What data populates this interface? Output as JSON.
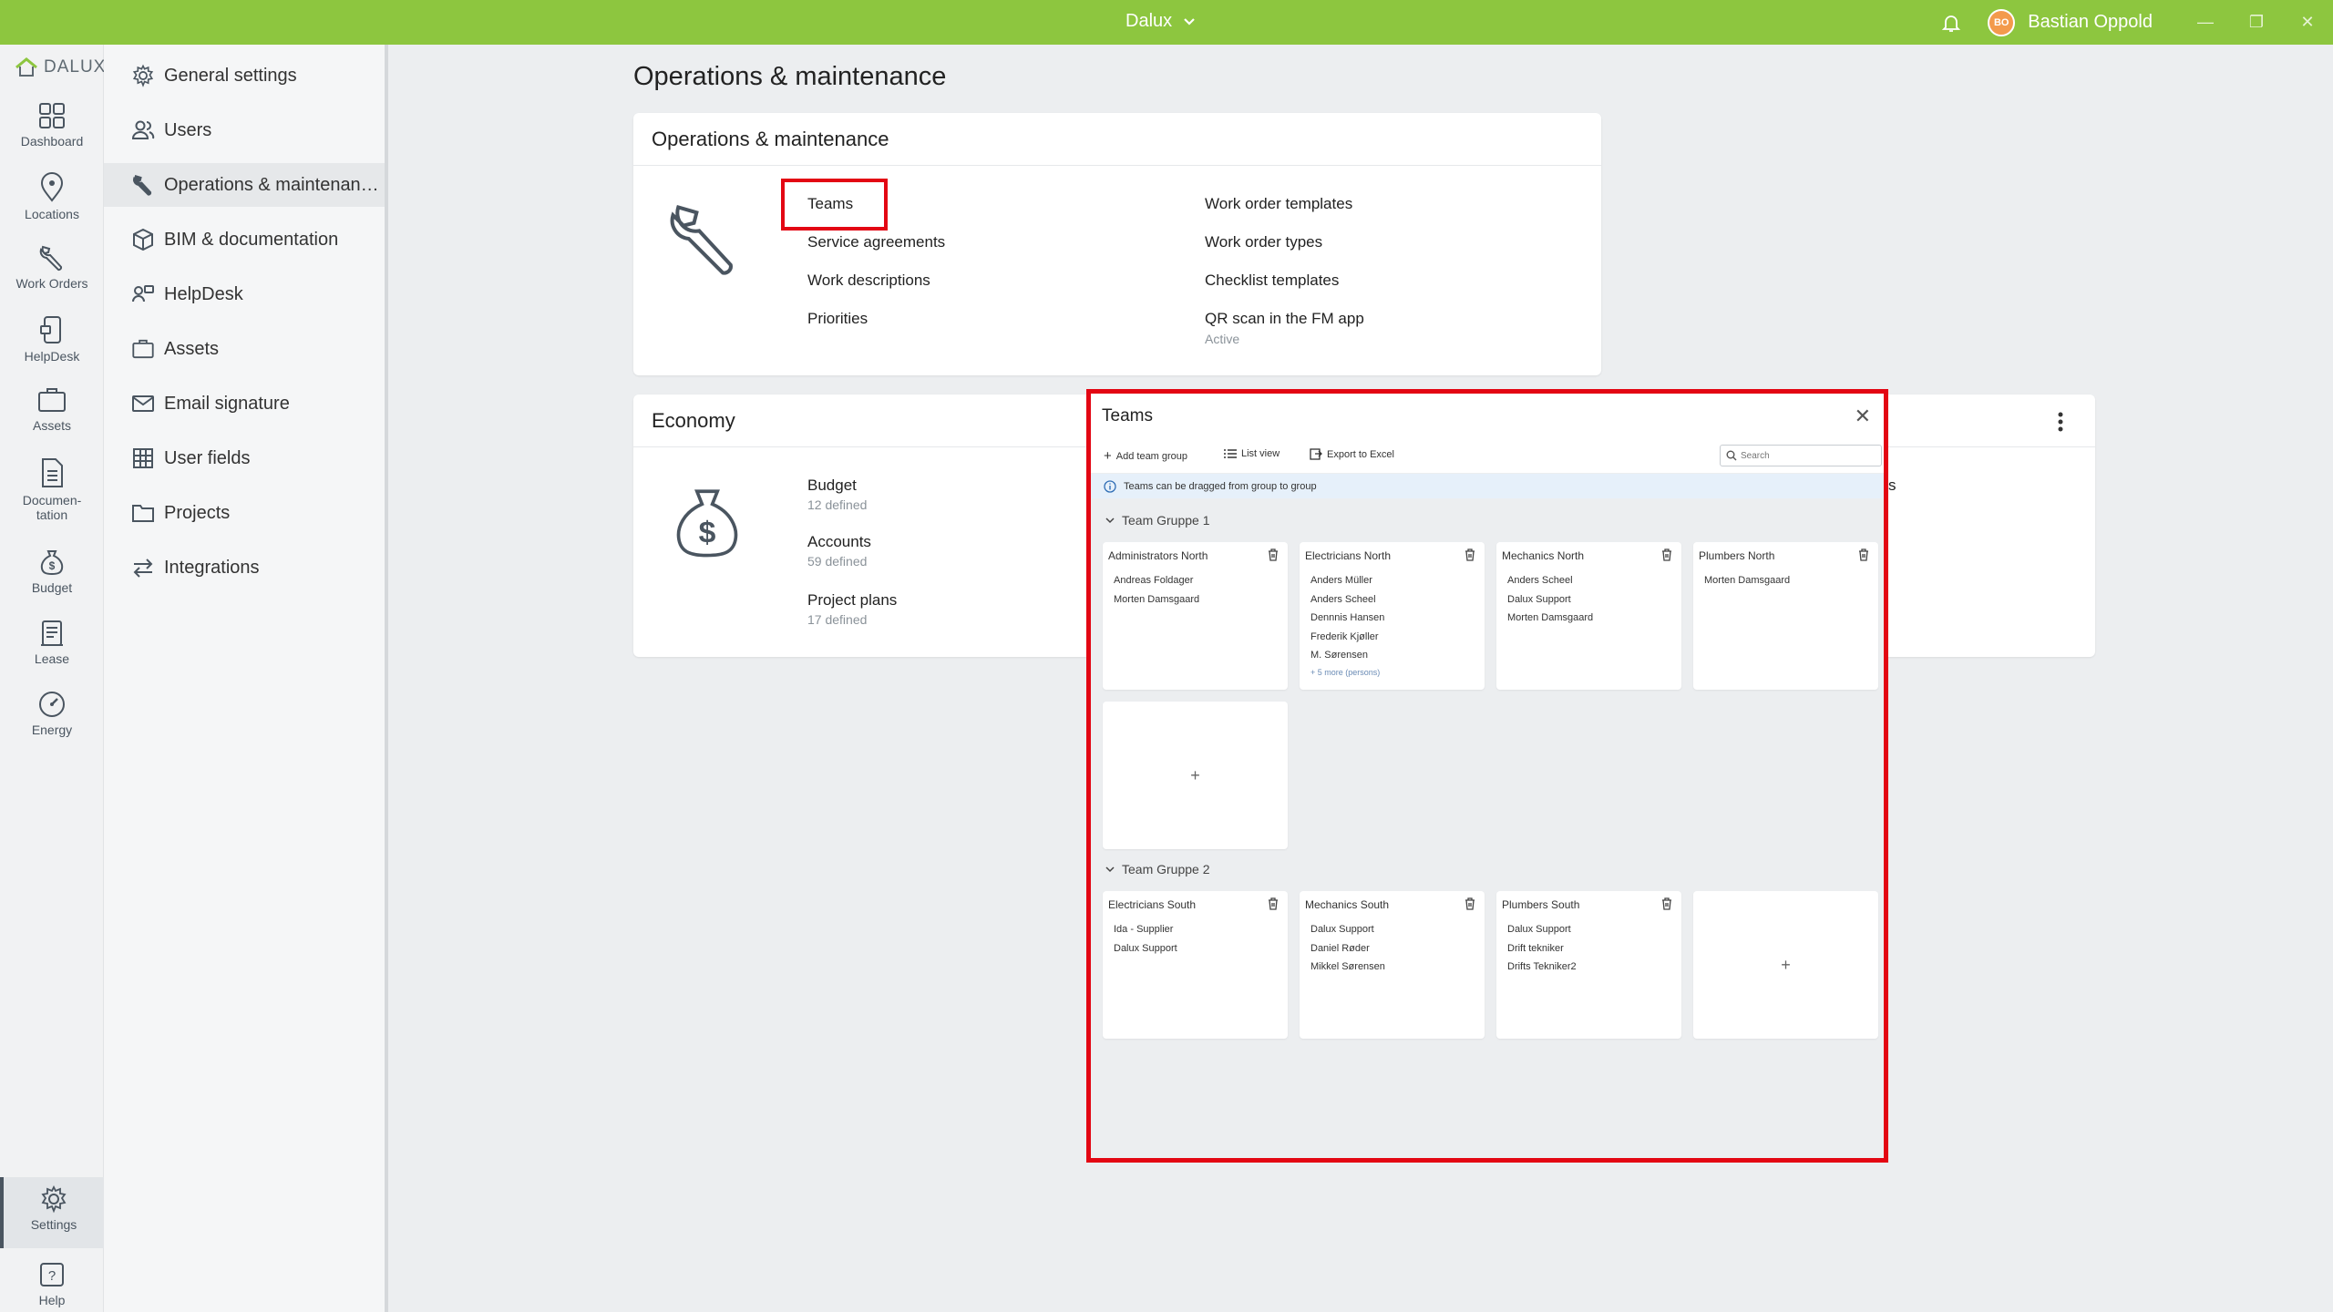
{
  "titlebar": {
    "workspace": "Dalux",
    "user_initials": "BO",
    "user_name": "Bastian Oppold",
    "accent": "#8dc63f"
  },
  "rail": {
    "logo": "DALUX",
    "items": [
      {
        "label": "Dashboard",
        "icon": "grid-icon"
      },
      {
        "label": "Locations",
        "icon": "pin-icon"
      },
      {
        "label": "Work Orders",
        "icon": "wrench-icon"
      },
      {
        "label": "HelpDesk",
        "icon": "phone-icon"
      },
      {
        "label": "Assets",
        "icon": "case-icon"
      },
      {
        "label": "Documen-",
        "label2": "tation",
        "icon": "doc-icon"
      },
      {
        "label": "Budget",
        "icon": "money-bag-icon"
      },
      {
        "label": "Lease",
        "icon": "lease-icon"
      },
      {
        "label": "Energy",
        "icon": "gauge-icon"
      }
    ],
    "settings": "Settings",
    "help": "Help"
  },
  "settings_nav": {
    "items": [
      {
        "label": "General settings",
        "icon": "gear-icon"
      },
      {
        "label": "Users",
        "icon": "users-icon"
      },
      {
        "label": "Operations & maintenan…",
        "icon": "wrench-icon"
      },
      {
        "label": "BIM & documentation",
        "icon": "cube-icon"
      },
      {
        "label": "HelpDesk",
        "icon": "helpdesk-icon"
      },
      {
        "label": "Assets",
        "icon": "case-icon"
      },
      {
        "label": "Email signature",
        "icon": "mail-icon"
      },
      {
        "label": "User fields",
        "icon": "table-icon"
      },
      {
        "label": "Projects",
        "icon": "folder-icon"
      },
      {
        "label": "Integrations",
        "icon": "arrows-icon"
      }
    ]
  },
  "main": {
    "page_title": "Operations & maintenance",
    "om_card": {
      "title": "Operations & maintenance",
      "left_links": [
        "Teams",
        "Service agreements",
        "Work descriptions",
        "Priorities"
      ],
      "right_links": [
        "Work order templates",
        "Work order types",
        "Checklist templates",
        "QR scan in the FM app"
      ],
      "qr_status": "Active"
    },
    "economy_card": {
      "title": "Economy",
      "items": [
        {
          "label": "Budget",
          "sub": "12 defined"
        },
        {
          "label": "Accounts",
          "sub": "59 defined"
        },
        {
          "label": "Project plans",
          "sub": "17 defined"
        }
      ],
      "partial_text": "s"
    }
  },
  "modal": {
    "title": "Teams",
    "toolbar": {
      "add_group": "Add team group",
      "list_view": "List view",
      "export": "Export to Excel",
      "search_placeholder": "Search"
    },
    "info": "Teams can be dragged from group to group",
    "groups": [
      {
        "name": "Team Gruppe 1",
        "teams": [
          {
            "name": "Administrators North",
            "members": [
              "Andreas Foldager",
              "Morten Damsgaard"
            ]
          },
          {
            "name": "Electricians North",
            "members": [
              "Anders Müller",
              "Anders Scheel",
              "Dennnis Hansen",
              "Frederik Kjøller",
              "M. Sørensen"
            ],
            "more": "+ 5 more (persons)"
          },
          {
            "name": "Mechanics North",
            "members": [
              "Anders Scheel",
              "Dalux Support",
              "Morten Damsgaard"
            ]
          },
          {
            "name": "Plumbers North",
            "members": [
              "Morten Damsgaard"
            ]
          }
        ]
      },
      {
        "name": "Team Gruppe 2",
        "teams": [
          {
            "name": "Electricians South",
            "members": [
              "Ida - Supplier",
              "Dalux Support"
            ]
          },
          {
            "name": "Mechanics South",
            "members": [
              "Dalux Support",
              "Daniel Røder",
              "Mikkel Sørensen"
            ]
          },
          {
            "name": "Plumbers South",
            "members": [
              "Dalux Support",
              "Drift tekniker",
              "Drifts Tekniker2"
            ]
          }
        ]
      }
    ],
    "add_symbol": "+"
  }
}
